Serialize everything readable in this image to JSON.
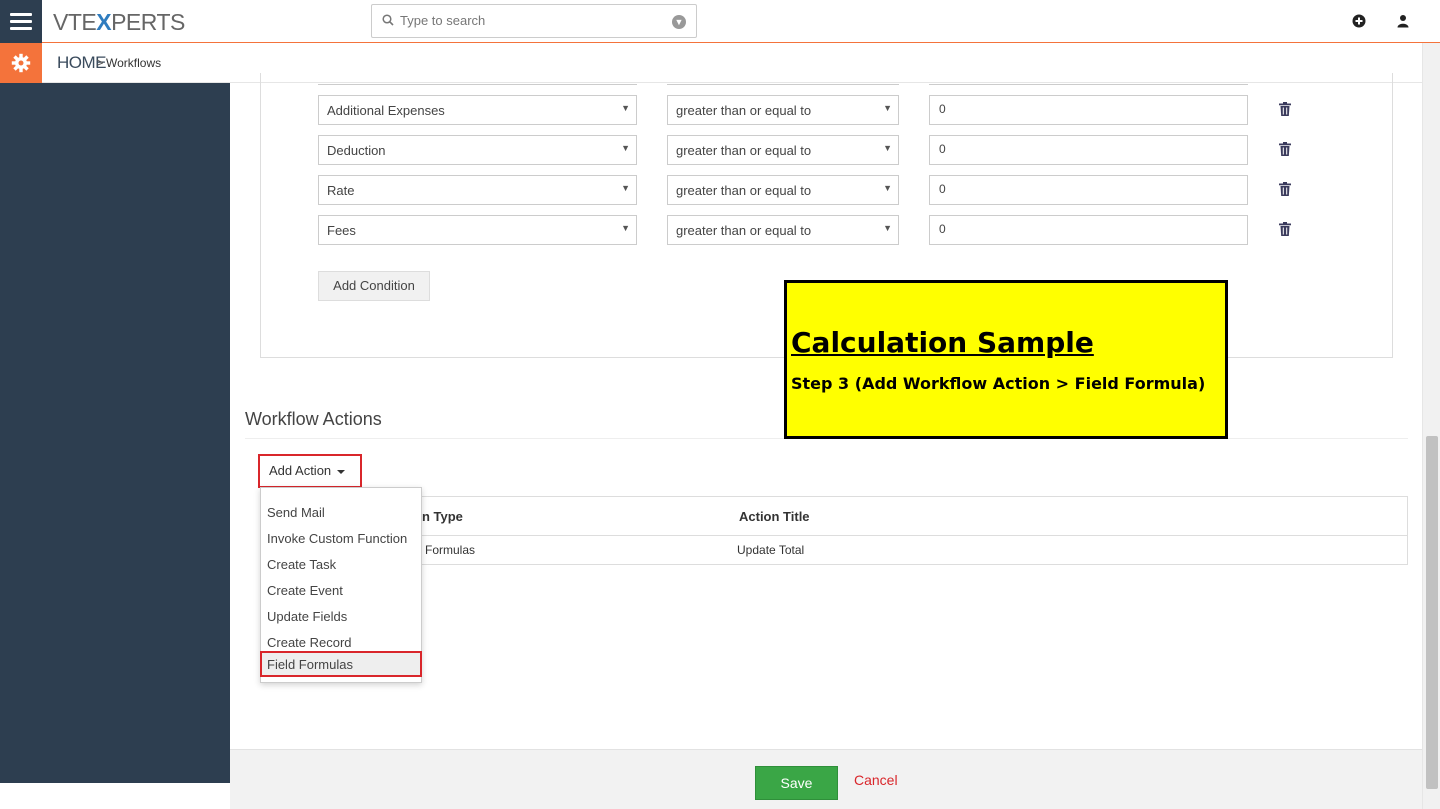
{
  "header": {
    "logo_left": "VTE",
    "logo_x": "X",
    "logo_right": "PERTS",
    "search_placeholder": "Type to search"
  },
  "breadcrumb": {
    "home": "HOME",
    "separator": ">",
    "current": "Workflows"
  },
  "conditions": [
    {
      "field": "Additional Expenses",
      "operator": "greater than or equal to",
      "value": "0"
    },
    {
      "field": "Deduction",
      "operator": "greater than or equal to",
      "value": "0"
    },
    {
      "field": "Rate",
      "operator": "greater than or equal to",
      "value": "0"
    },
    {
      "field": "Fees",
      "operator": "greater than or equal to",
      "value": "0"
    }
  ],
  "add_condition_label": "Add Condition",
  "note": {
    "title": "Calculation Sample",
    "subtitle": "Step 3 (Add Workflow Action > Field Formula)"
  },
  "workflow_actions": {
    "heading": "Workflow Actions",
    "add_action_label": "Add Action",
    "menu_items": [
      "Send Mail",
      "Invoke Custom Function",
      "Create Task",
      "Create Event",
      "Update Fields",
      "Create Record",
      "Field Formulas"
    ],
    "selected_item": "Field Formulas",
    "table": {
      "headers": [
        "on Type",
        "Action Title"
      ],
      "row": [
        "Formulas",
        "Update Total"
      ]
    }
  },
  "footer": {
    "save_label": "Save",
    "cancel_label": "Cancel"
  },
  "colors": {
    "accent_orange": "#f4733b",
    "sidebar": "#2d3e50",
    "save_green": "#3aa646",
    "cancel_red": "#d9262b",
    "note_yellow": "#ffff00"
  }
}
